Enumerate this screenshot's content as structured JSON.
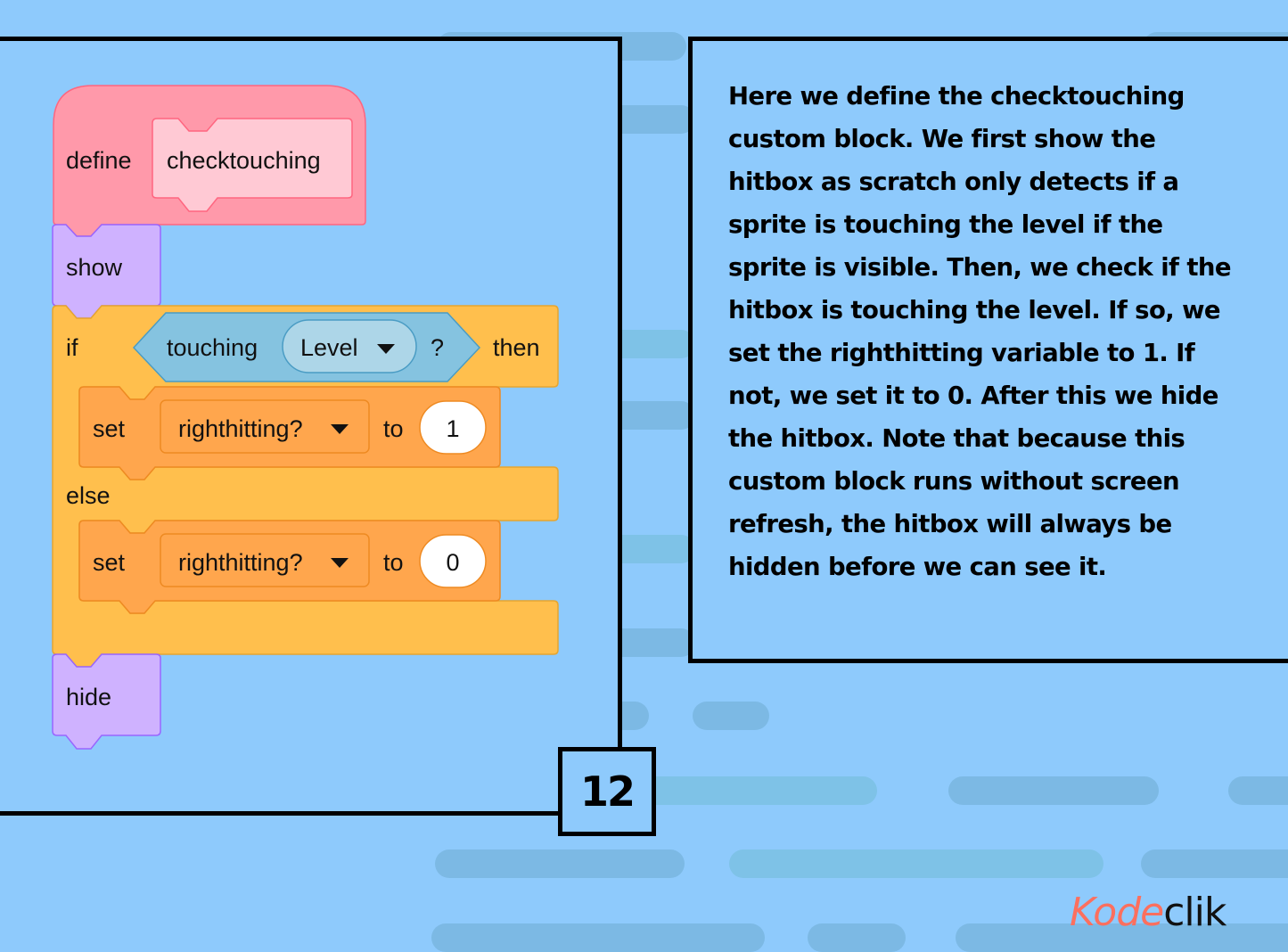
{
  "colors": {
    "background": "#8ecafc",
    "define_block": "#ff99aa",
    "define_inner": "#ffc9d4",
    "looks_block": "#cfb2ff",
    "control_block": "#ffbf4d",
    "sensing_block": "#85c3e0",
    "variable_block": "#ffa64d",
    "logo_accent": "#fc6f5e"
  },
  "code": {
    "define": {
      "keyword": "define",
      "name": "checktouching"
    },
    "show": {
      "label": "show"
    },
    "if_block": {
      "if_label": "if",
      "condition": {
        "label": "touching",
        "target": "Level",
        "suffix": "?"
      },
      "then_label": "then",
      "else_label": "else"
    },
    "set_true": {
      "keyword": "set",
      "variable": "righthitting?",
      "to_label": "to",
      "value": "1"
    },
    "set_false": {
      "keyword": "set",
      "variable": "righthitting?",
      "to_label": "to",
      "value": "0"
    },
    "hide": {
      "label": "hide"
    }
  },
  "explanation": "Here we define the checktouching custom block. We first show the hitbox as scratch only detects if a sprite is touching the level if the sprite is visible. Then, we check if the hitbox is touching the level. If so, we set the righthitting variable to 1. If not, we set it to 0. After this we hide the hitbox. Note that because this custom block runs without screen refresh, the hitbox will always be hidden before we can see it.",
  "page_number": "12",
  "logo": {
    "part1": "Kode",
    "part2": "clik"
  }
}
